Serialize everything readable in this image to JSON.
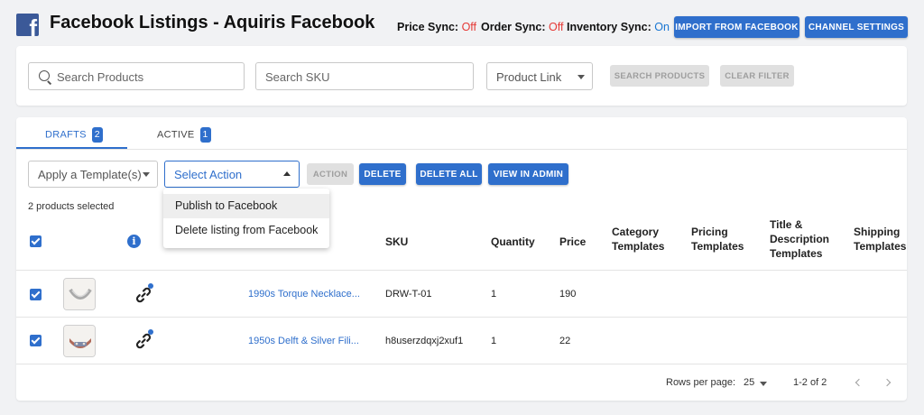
{
  "header": {
    "title": "Facebook Listings - Aquiris Facebook",
    "price_sync_label": "Price Sync:",
    "price_sync_value": "Off",
    "order_sync_label": "Order Sync:",
    "order_sync_value": "Off",
    "inventory_sync_label": "Inventory Sync:",
    "inventory_sync_value": "On",
    "import_button": "IMPORT FROM FACEBOOK",
    "settings_button": "CHANNEL SETTINGS"
  },
  "filters": {
    "search_products_placeholder": "Search Products",
    "search_sku_placeholder": "Search SKU",
    "product_link_select": "Product Link",
    "search_button": "SEARCH PRODUCTS",
    "clear_button": "CLEAR FILTER"
  },
  "tabs": [
    {
      "label": "DRAFTS",
      "count": "2"
    },
    {
      "label": "ACTIVE",
      "count": "1"
    }
  ],
  "toolbar": {
    "template_select": "Apply a Template(s)",
    "action_select": "Select Action",
    "action_button": "ACTION",
    "delete_button": "DELETE",
    "delete_all_button": "DELETE ALL",
    "view_admin_button": "VIEW IN ADMIN"
  },
  "action_menu": {
    "items": [
      "Publish to Facebook",
      "Delete listing from Facebook"
    ]
  },
  "selection_text": "2 products selected",
  "table": {
    "columns": {
      "sku": "SKU",
      "quantity": "Quantity",
      "price": "Price",
      "category_templates": "Category Templates",
      "pricing_templates": "Pricing Templates",
      "title_description_templates": "Title & Description Templates",
      "shipping_templates": "Shipping Templates"
    },
    "rows": [
      {
        "title": "1990s Torque Necklace...",
        "sku": "DRW-T-01",
        "quantity": "1",
        "price": "190"
      },
      {
        "title": "1950s Delft & Silver Fili...",
        "sku": "h8userzdqxj2xuf1",
        "quantity": "1",
        "price": "22"
      }
    ]
  },
  "pagination": {
    "rows_label": "Rows per page:",
    "rows_value": "25",
    "range": "1-2 of 2"
  },
  "colors": {
    "primary": "#2f6fcc",
    "off": "#e53935",
    "on": "#1976d2"
  }
}
